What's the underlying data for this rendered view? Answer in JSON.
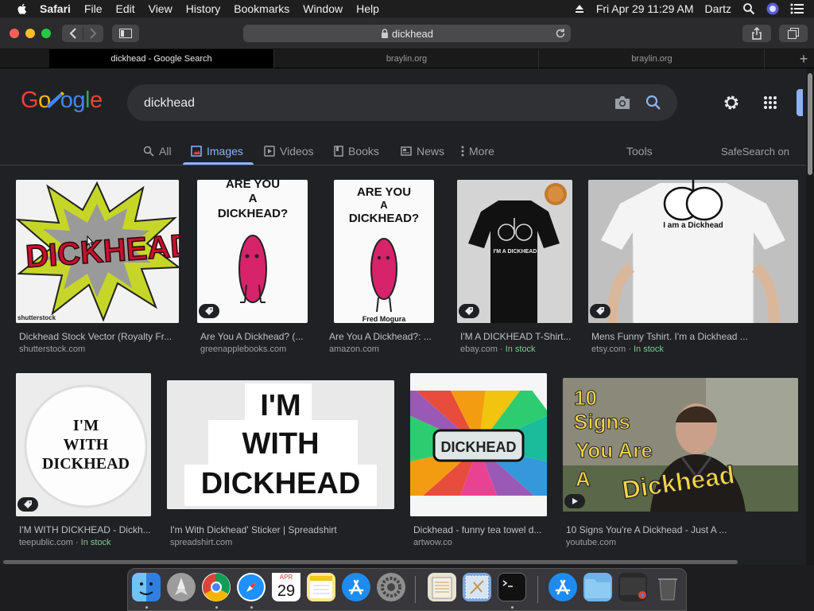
{
  "menubar": {
    "app": "Safari",
    "items": [
      "File",
      "Edit",
      "View",
      "History",
      "Bookmarks",
      "Window",
      "Help"
    ],
    "clock": "Fri Apr 29  11:29 AM",
    "user": "Dartz"
  },
  "browser": {
    "address": "dickhead",
    "tabs": [
      "dickhead - Google Search",
      "braylin.org",
      "braylin.org"
    ]
  },
  "google": {
    "logo": "Google",
    "query": "dickhead",
    "nav": [
      "All",
      "Images",
      "Videos",
      "Books",
      "News",
      "More"
    ],
    "tools": "Tools",
    "safesearch": "SafeSearch on",
    "results": [
      {
        "title": "Dickhead Stock Vector (Royalty Fr...",
        "source": "shutterstock.com",
        "stock": "",
        "art": "DICKHEAD!",
        "watermark": "shutterstock"
      },
      {
        "title": "Are You A Dickhead? (...",
        "source": "greenapplebooks.com",
        "stock": "",
        "art": "ARE YOU A DICKHEAD?"
      },
      {
        "title": "Are You A Dickhead?: ...",
        "source": "amazon.com",
        "stock": "",
        "art": "ARE YOU A DICKHEAD?",
        "author": "Fred Mogura"
      },
      {
        "title": "I'M A DICKHEAD T-Shirt...",
        "source": "ebay.com",
        "stock": "In stock",
        "art": "I'M A DICKHEAD"
      },
      {
        "title": "Mens Funny Tshirt. I'm a Dickhead ...",
        "source": "etsy.com",
        "stock": "In stock",
        "art": "I am a Dickhead"
      },
      {
        "title": "I'M WITH DICKHEAD - Dickh...",
        "source": "teepublic.com",
        "stock": "In stock",
        "art": "I'M WITH DICKHEAD"
      },
      {
        "title": "I'm With Dickhead' Sticker | Spreadshirt",
        "source": "spreadshirt.com",
        "stock": "",
        "art": "I'M WITH DICKHEAD"
      },
      {
        "title": "Dickhead - funny tea towel d...",
        "source": "artwow.co",
        "stock": "",
        "art": "DICKHEAD"
      },
      {
        "title": "10 Signs You're A Dickhead - Just A ...",
        "source": "youtube.com",
        "stock": "",
        "art": "10 Signs You Are A Dickhead"
      }
    ]
  },
  "dock": {
    "calendar_month": "APR",
    "calendar_day": "29"
  }
}
